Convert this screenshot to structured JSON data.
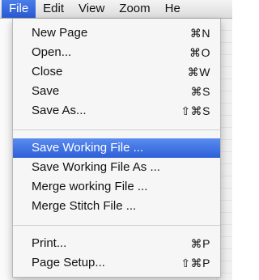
{
  "menubar": {
    "items": [
      {
        "label": "File"
      },
      {
        "label": "Edit"
      },
      {
        "label": "View"
      },
      {
        "label": "Zoom"
      },
      {
        "label": "He"
      }
    ]
  },
  "file_menu": {
    "groups": [
      [
        {
          "label": "New Page",
          "shortcut": "⌘N"
        },
        {
          "label": "Open...",
          "shortcut": "⌘O"
        },
        {
          "label": "Close",
          "shortcut": "⌘W"
        },
        {
          "label": "Save",
          "shortcut": "⌘S"
        },
        {
          "label": "Save As...",
          "shortcut": "⇧⌘S"
        }
      ],
      [
        {
          "label": "Save Working File ...",
          "shortcut": ""
        },
        {
          "label": "Save Working File As ...",
          "shortcut": ""
        },
        {
          "label": "Merge working File ...",
          "shortcut": ""
        },
        {
          "label": "Merge Stitch File ...",
          "shortcut": ""
        }
      ],
      [
        {
          "label": "Print...",
          "shortcut": "⌘P"
        },
        {
          "label": "Page Setup...",
          "shortcut": "⇧⌘P"
        }
      ]
    ]
  },
  "colors": {
    "highlight": "#2d5fd8",
    "menu_bg": "#f6f6f6"
  }
}
